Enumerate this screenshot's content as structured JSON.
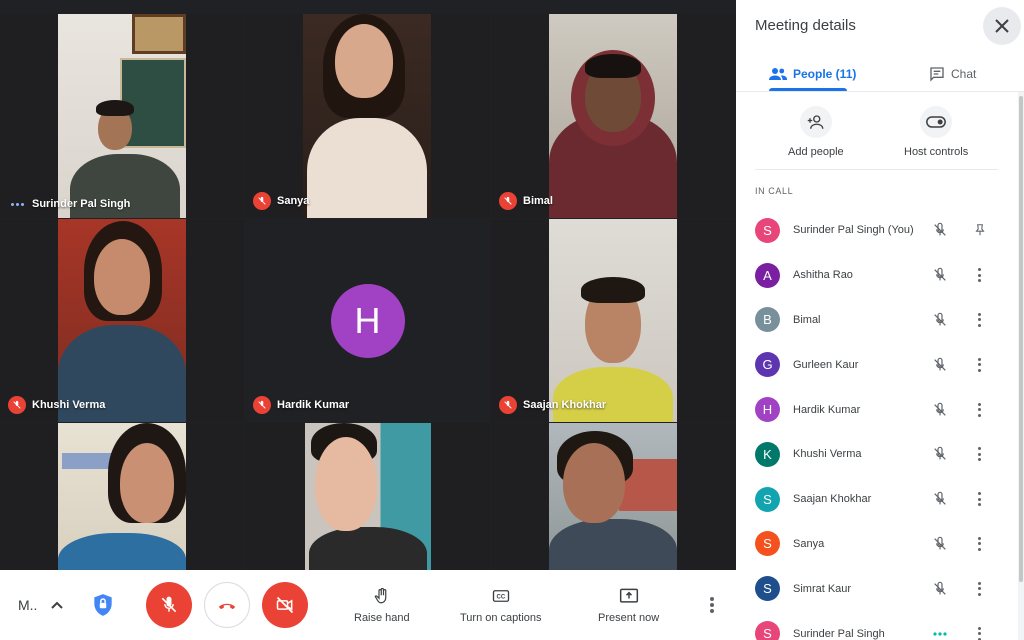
{
  "grid": {
    "tiles": [
      {
        "name": "Surinder Pal Singh",
        "status": "speaking"
      },
      {
        "name": "Sanya",
        "status": "muted"
      },
      {
        "name": "Bimal",
        "status": "muted"
      },
      {
        "name": "Khushi Verma",
        "status": "muted"
      },
      {
        "name": "Hardik Kumar",
        "status": "muted",
        "avatar_letter": "H"
      },
      {
        "name": "Saajan Khokhar",
        "status": "muted"
      },
      {
        "name": "",
        "status": "none"
      },
      {
        "name": "",
        "status": "none"
      },
      {
        "name": "",
        "status": "none"
      }
    ]
  },
  "bottombar": {
    "meeting_code": "M..",
    "raise_hand": "Raise hand",
    "captions": "Turn on captions",
    "present": "Present now"
  },
  "panel": {
    "title": "Meeting details",
    "tabs": {
      "people": "People (11)",
      "chat": "Chat"
    },
    "actions": {
      "add_people": "Add people",
      "host_controls": "Host controls"
    },
    "section_label": "IN CALL",
    "people": [
      {
        "letter": "S",
        "name": "Surinder Pal Singh (You)",
        "color": "#e8457a",
        "trailing": "pin"
      },
      {
        "letter": "A",
        "name": "Ashitha Rao",
        "color": "#7b1fa2",
        "trailing": "more"
      },
      {
        "letter": "B",
        "name": "Bimal",
        "color": "#78909c",
        "trailing": "more"
      },
      {
        "letter": "G",
        "name": "Gurleen Kaur",
        "color": "#5e35b1",
        "trailing": "more"
      },
      {
        "letter": "H",
        "name": "Hardik Kumar",
        "color": "#a142c4",
        "trailing": "more"
      },
      {
        "letter": "K",
        "name": "Khushi Verma",
        "color": "#00796b",
        "trailing": "more"
      },
      {
        "letter": "S",
        "name": "Saajan Khokhar",
        "color": "#12a4af",
        "trailing": "more"
      },
      {
        "letter": "S",
        "name": "Sanya",
        "color": "#f4511e",
        "trailing": "more"
      },
      {
        "letter": "S",
        "name": "Simrat Kaur",
        "color": "#1e4f8c",
        "trailing": "more"
      },
      {
        "letter": "S",
        "name": "Surinder Pal Singh",
        "color": "#e8457a",
        "trailing": "more",
        "speaking": true
      }
    ]
  },
  "colors": {
    "accent": "#1a73e8",
    "danger": "#ea4335"
  }
}
